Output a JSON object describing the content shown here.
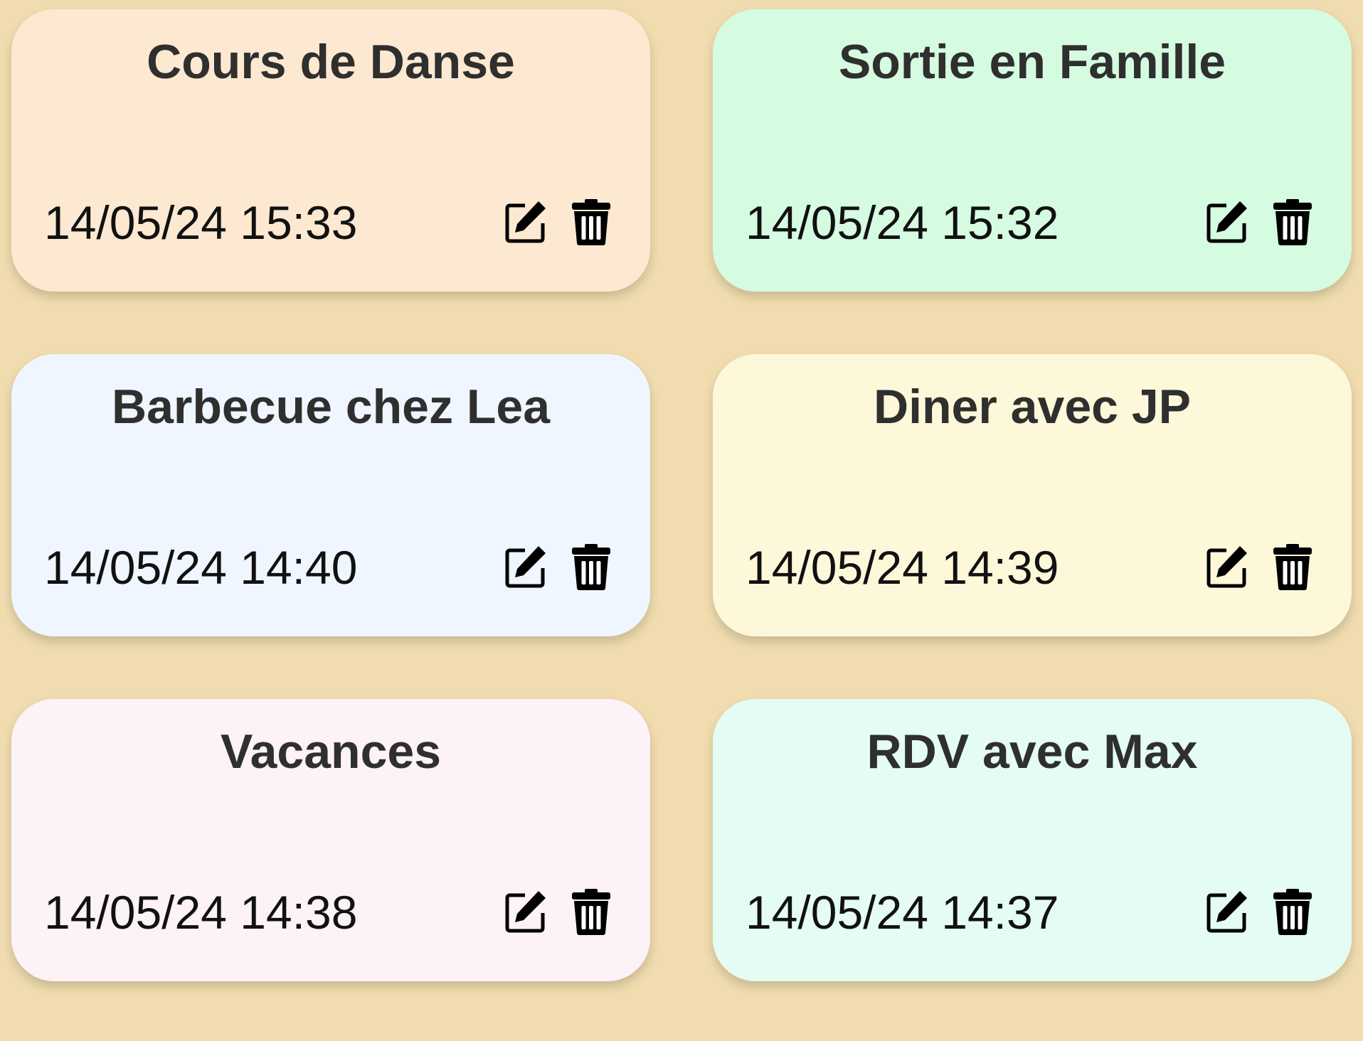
{
  "notes": [
    {
      "title": "Cours de Danse",
      "date": "14/05/24 15:33",
      "color": "#fde9d1",
      "edit_icon": "edit-icon",
      "delete_icon": "trash-icon"
    },
    {
      "title": "Sortie en Famille",
      "date": "14/05/24 15:32",
      "color": "#d5fbe1",
      "edit_icon": "edit-icon",
      "delete_icon": "trash-icon"
    },
    {
      "title": "Barbecue chez Lea",
      "date": "14/05/24 14:40",
      "color": "#eff6ff",
      "edit_icon": "edit-icon",
      "delete_icon": "trash-icon"
    },
    {
      "title": "Diner avec JP",
      "date": "14/05/24 14:39",
      "color": "#fef8da",
      "edit_icon": "edit-icon",
      "delete_icon": "trash-icon"
    },
    {
      "title": "Vacances",
      "date": "14/05/24 14:38",
      "color": "#fdf2f7",
      "edit_icon": "edit-icon",
      "delete_icon": "trash-icon"
    },
    {
      "title": "RDV avec Max",
      "date": "14/05/24 14:37",
      "color": "#e4fcf4",
      "edit_icon": "edit-icon",
      "delete_icon": "trash-icon"
    }
  ],
  "colors": {
    "background": "#f0dcae",
    "title_text": "#2f2f2f",
    "date_text": "#111111",
    "icon": "#000000"
  }
}
